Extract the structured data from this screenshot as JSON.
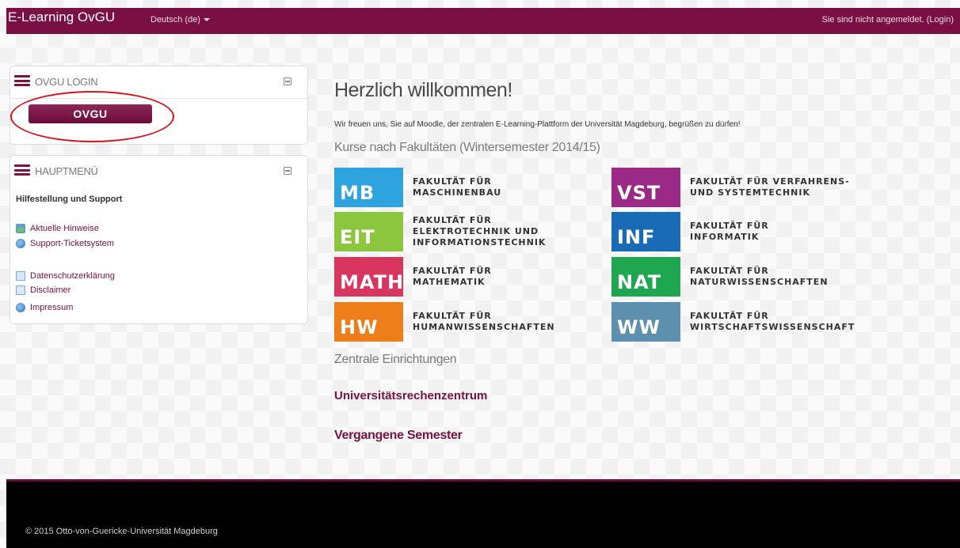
{
  "navbar": {
    "brand": "E-Learning OvGU",
    "language": "Deutsch (de)",
    "login_status": "Sie sind nicht angemeldet.",
    "login_link": "(Login)"
  },
  "login_block": {
    "title": "OVGU LOGIN",
    "button": "OVGU"
  },
  "main_menu": {
    "title": "HAUPTMENÜ",
    "section": "Hilfestellung und Support",
    "items": [
      {
        "label": "Aktuelle Hinweise",
        "icon": "news-icon"
      },
      {
        "label": "Support-Ticketsystem",
        "icon": "globe-icon"
      },
      {
        "label": "Datenschutzerklärung",
        "icon": "page-icon"
      },
      {
        "label": "Disclaimer",
        "icon": "page-icon"
      },
      {
        "label": "Impressum",
        "icon": "globe-icon"
      }
    ]
  },
  "main": {
    "title": "Herzlich willkommen!",
    "intro": "Wir freuen uns, Sie auf Moodle, der zentralen E-Learning-Plattform der Universität Magdeburg, begrüßen zu dürfen!",
    "courses_heading": "Kurse nach Fakultäten (Wintersemester 2014/15)",
    "faculties": [
      {
        "abbr": "MB",
        "line1": "FAKULTÄT FÜR",
        "line2": "MASCHINENBAU",
        "line3": "",
        "color": "#2ea3dd"
      },
      {
        "abbr": "VST",
        "line1": "FAKULTÄT FÜR VERFAHRENS-",
        "line2": "UND SYSTEMTECHNIK",
        "line3": "",
        "color": "#9b2a86"
      },
      {
        "abbr": "EIT",
        "line1": "FAKULTÄT FÜR",
        "line2": "ELEKTROTECHNIK UND",
        "line3": "INFORMATIONSTECHNIK",
        "color": "#8cc63f"
      },
      {
        "abbr": "INF",
        "line1": "FAKULTÄT FÜR",
        "line2": "INFORMATIK",
        "line3": "",
        "color": "#1a6bb5"
      },
      {
        "abbr": "MATH",
        "line1": "FAKULTÄT FÜR",
        "line2": "MATHEMATIK",
        "line3": "",
        "color": "#d8365e"
      },
      {
        "abbr": "NAT",
        "line1": "FAKULTÄT FÜR",
        "line2": "NATURWISSENSCHAFTEN",
        "line3": "",
        "color": "#1ea650"
      },
      {
        "abbr": "HW",
        "line1": "FAKULTÄT FÜR",
        "line2": "HUMANWISSENSCHAFTEN",
        "line3": "",
        "color": "#ee7e1a"
      },
      {
        "abbr": "WW",
        "line1": "FAKULTÄT FÜR",
        "line2": "WIRTSCHAFTSWISSENSCHAFT",
        "line3": "",
        "color": "#5d8fae"
      }
    ],
    "central_heading": "Zentrale Einrichtungen",
    "computing_center": "Universitätsrechenzentrum",
    "past_semesters": "Vergangene Semester"
  },
  "footer": {
    "copyright": "© 2015 Otto-von-Guericke-Universität Magdeburg"
  },
  "colors": {
    "brand": "#7a0f43",
    "annotation": "#d8141b"
  }
}
